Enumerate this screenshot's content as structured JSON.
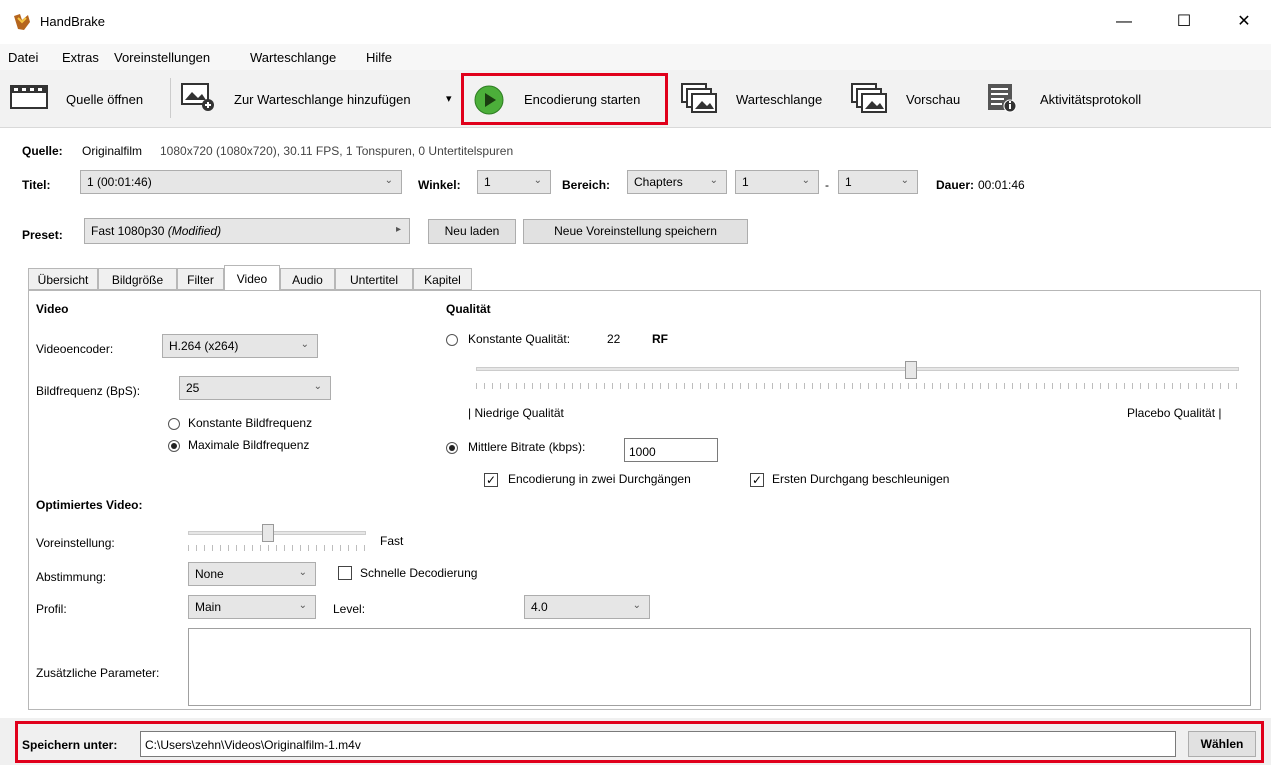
{
  "window": {
    "title": "HandBrake",
    "min": "—",
    "max": "☐",
    "close": "✕"
  },
  "menu": [
    "Datei",
    "Extras",
    "Voreinstellungen",
    "Warteschlange",
    "Hilfe"
  ],
  "toolbar": {
    "open_source": "Quelle öffnen",
    "add_queue": "Zur Warteschlange hinzufügen",
    "add_queue_arrow": "▾",
    "start_encode": "Encodierung starten",
    "queue": "Warteschlange",
    "preview": "Vorschau",
    "activity_log": "Aktivitätsprotokoll"
  },
  "source": {
    "label": "Quelle:",
    "name": "Originalfilm",
    "info": "1080x720 (1080x720), 30.11 FPS, 1 Tonspuren, 0 Untertitelspuren"
  },
  "title_row": {
    "title_label": "Titel:",
    "title_value": "1 (00:01:46)",
    "angle_label": "Winkel:",
    "angle_value": "1",
    "range_label": "Bereich:",
    "range_value": "Chapters",
    "range_from": "1",
    "range_sep": "-",
    "range_to": "1",
    "duration_label": "Dauer:",
    "duration_value": "00:01:46"
  },
  "preset": {
    "label": "Preset:",
    "value": "Fast 1080p30",
    "modified": "(Modified)",
    "arrow": "▸",
    "reload": "Neu laden",
    "save_new": "Neue Voreinstellung speichern"
  },
  "tabs": [
    "Übersicht",
    "Bildgröße",
    "Filter",
    "Video",
    "Audio",
    "Untertitel",
    "Kapitel"
  ],
  "video": {
    "section": "Video",
    "encoder_label": "Videoencoder:",
    "encoder_value": "H.264 (x264)",
    "fps_label": "Bildfrequenz (BpS):",
    "fps_value": "25",
    "constant_fps": "Konstante Bildfrequenz",
    "peak_fps": "Maximale Bildfrequenz"
  },
  "quality": {
    "section": "Qualität",
    "cq_label": "Konstante Qualität:",
    "cq_value": "22",
    "cq_unit": "RF",
    "cq_slider_level": 0.57,
    "low_label": "| Niedrige Qualität",
    "high_label": "Placebo Qualität |",
    "abr_label": "Mittlere Bitrate (kbps):",
    "abr_value": "1000",
    "two_pass": "Encodierung in zwei Durchgängen",
    "turbo": "Ersten Durchgang beschleunigen",
    "check_mark": "✓"
  },
  "optimized": {
    "section": "Optimiertes Video:",
    "preset_label": "Voreinstellung:",
    "preset_value": "Fast",
    "preset_slider_level": 0.45,
    "tune_label": "Abstimmung:",
    "tune_value": "None",
    "fast_decode": "Schnelle Decodierung",
    "profile_label": "Profil:",
    "profile_value": "Main",
    "level_label": "Level:",
    "level_value": "4.0",
    "extra_label": "Zusätzliche Parameter:"
  },
  "save": {
    "label": "Speichern unter:",
    "path": "C:\\Users\\zehn\\Videos\\Originalfilm-1.m4v",
    "browse": "Wählen"
  },
  "dropdown_arrow": "⌄",
  "colors": {
    "highlight": "#e0001b",
    "play_green": "#4caf3a"
  }
}
